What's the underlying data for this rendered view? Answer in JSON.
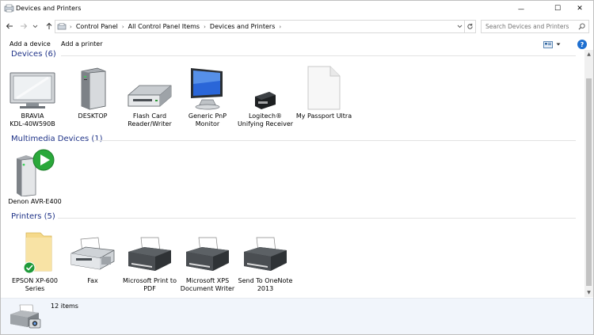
{
  "window": {
    "title": "Devices and Printers",
    "minimize_glyph": "—",
    "maximize_glyph": "☐",
    "close_glyph": "✕"
  },
  "address": {
    "breadcrumbs": [
      "Control Panel",
      "All Control Panel Items",
      "Devices and Printers"
    ],
    "search_placeholder": "Search Devices and Printers"
  },
  "commands": {
    "add_device": "Add a device",
    "add_printer": "Add a printer",
    "help": "?"
  },
  "groups": {
    "devices": {
      "header": "Devices (6)",
      "items": [
        {
          "label": "BRAVIA\nKDL-40W590B",
          "icon": "tv-icon"
        },
        {
          "label": "DESKTOP",
          "icon": "computer-tower-icon"
        },
        {
          "label": "Flash Card\nReader/Writer",
          "icon": "card-reader-icon"
        },
        {
          "label": "Generic PnP\nMonitor",
          "icon": "monitor-icon"
        },
        {
          "label": "Logitech®\nUnifying Receiver",
          "icon": "usb-receiver-icon"
        },
        {
          "label": "My Passport Ultra",
          "icon": "blank-file-icon"
        }
      ]
    },
    "multimedia": {
      "header": "Multimedia Devices (1)",
      "items": [
        {
          "label": "Denon AVR-E400",
          "icon": "media-device-icon"
        }
      ]
    },
    "printers": {
      "header": "Printers (5)",
      "items": [
        {
          "label": "EPSON XP-600\nSeries",
          "icon": "printer-folder-default-icon"
        },
        {
          "label": "Fax",
          "icon": "fax-icon"
        },
        {
          "label": "Microsoft Print to\nPDF",
          "icon": "printer-icon"
        },
        {
          "label": "Microsoft XPS\nDocument Writer",
          "icon": "printer-icon"
        },
        {
          "label": "Send To OneNote\n2013",
          "icon": "printer-icon"
        }
      ]
    }
  },
  "status": {
    "count": "12 items"
  },
  "colors": {
    "group_header": "#1e3287",
    "help_blue": "#1e6fd0",
    "status_bg": "#f1f5fb",
    "default_check": "#1f9a3a",
    "play_green": "#2aa83a"
  }
}
